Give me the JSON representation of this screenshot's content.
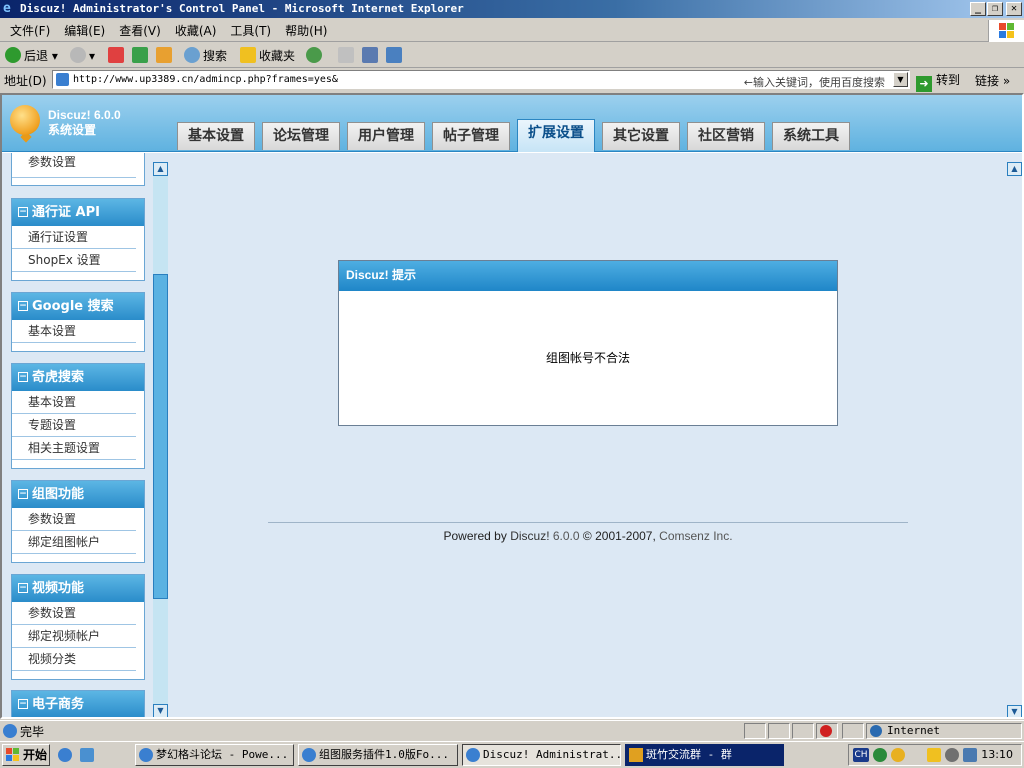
{
  "window": {
    "title": "Discuz! Administrator's Control Panel - Microsoft Internet Explorer",
    "buttons": [
      "minimize",
      "restore",
      "close"
    ]
  },
  "menubar": {
    "items": [
      "文件(F)",
      "编辑(E)",
      "查看(V)",
      "收藏(A)",
      "工具(T)",
      "帮助(H)"
    ]
  },
  "toolbar": {
    "back_label": "后退",
    "search_label": "搜索",
    "favorites_label": "收藏夹"
  },
  "addressbar": {
    "label": "地址(D)",
    "url": "http://www.up3389.cn/admincp.php?frames=yes&",
    "search_hint": "←输入关键词，使用百度搜索",
    "go_label": "转到",
    "links_label": "链接 »"
  },
  "header": {
    "version": "Discuz! 6.0.0",
    "subtitle": "系统设置",
    "tabs": [
      "基本设置",
      "论坛管理",
      "用户管理",
      "帖子管理",
      "扩展设置",
      "其它设置",
      "社区营销",
      "系统工具"
    ],
    "active_tab": "扩展设置"
  },
  "sidebar": {
    "top_item": "参数设置",
    "groups": [
      {
        "title": "通行证 API",
        "items": [
          "通行证设置",
          "ShopEx 设置"
        ]
      },
      {
        "title": "Google 搜索",
        "items": [
          "基本设置"
        ]
      },
      {
        "title": "奇虎搜索",
        "items": [
          "基本设置",
          "专题设置",
          "相关主题设置"
        ]
      },
      {
        "title": "组图功能",
        "items": [
          "参数设置",
          "绑定组图帐户"
        ]
      },
      {
        "title": "视频功能",
        "items": [
          "参数设置",
          "绑定视频帐户",
          "视频分类"
        ]
      },
      {
        "title": "电子商务",
        "items": []
      }
    ]
  },
  "message": {
    "title": "Discuz! 提示",
    "text": "组图帐号不合法"
  },
  "footer": {
    "powered_by": "Powered by",
    "product": "Discuz!",
    "version": "6.0.0",
    "copyright": "© 2001-2007,",
    "company": "Comsenz Inc."
  },
  "statusbar": {
    "text": "完毕",
    "zone": "Internet"
  },
  "taskbar": {
    "start_label": "开始",
    "tasks": [
      {
        "label": "梦幻格斗论坛 - Powe...",
        "state": "normal"
      },
      {
        "label": "组图服务插件1.0版Fo...",
        "state": "normal"
      },
      {
        "label": "Discuz! Administrat...",
        "state": "active"
      },
      {
        "label": "斑竹交流群 - 群",
        "state": "highlight"
      }
    ],
    "ime": "CH",
    "clock": "13:10"
  }
}
